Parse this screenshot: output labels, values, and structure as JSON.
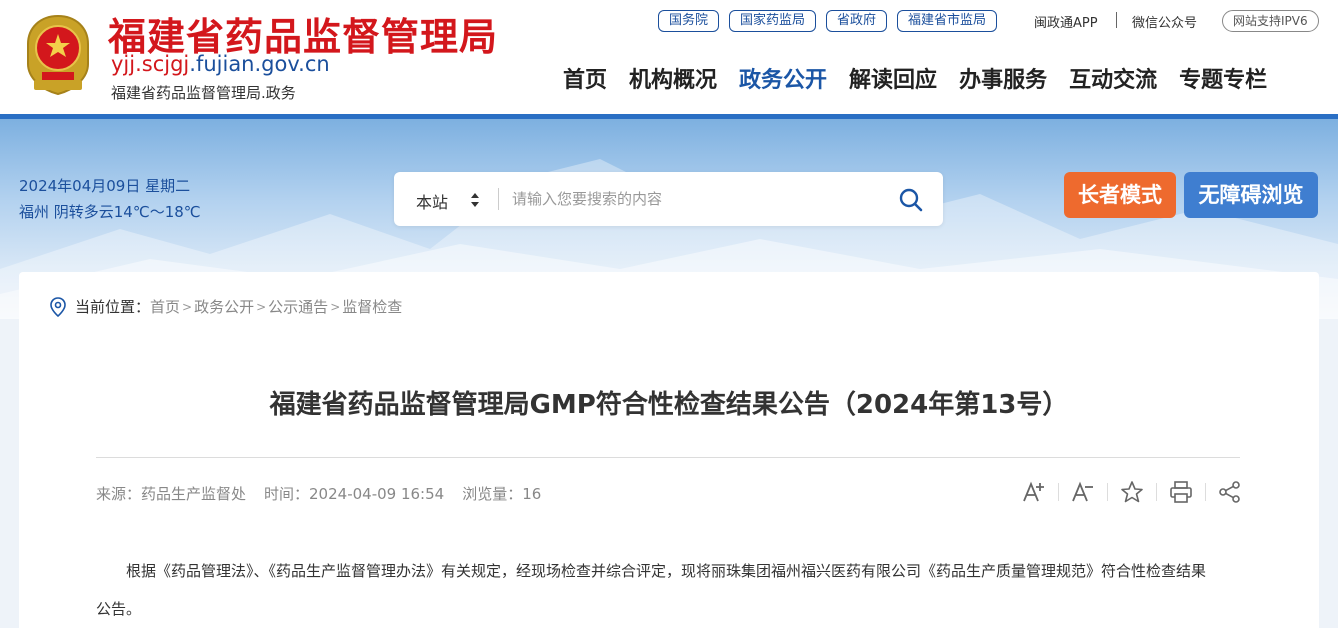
{
  "header": {
    "site_title": "福建省药品监督管理局",
    "domain_prefix": "yjj.scjgj",
    "domain_suffix": ".fujian.gov.cn",
    "subtitle": "福建省药品监督管理局.政务",
    "top_links": [
      "国务院",
      "国家药监局",
      "省政府",
      "福建省市监局"
    ],
    "app_link": "闽政通APP",
    "wechat_link": "微信公众号",
    "ipv6_badge": "网站支持IPV6"
  },
  "nav": {
    "items": [
      "首页",
      "机构概况",
      "政务公开",
      "解读回应",
      "办事服务",
      "互动交流",
      "专题专栏"
    ],
    "active": "政务公开"
  },
  "banner": {
    "date": "2024年04月09日 星期二",
    "weather": "福州 阴转多云14℃～18℃",
    "search_scope": "本站",
    "search_placeholder": "请输入您要搜索的内容",
    "elder_mode": "长者模式",
    "accessible": "无障碍浏览"
  },
  "breadcrumb": {
    "label": "当前位置：",
    "items": [
      "首页",
      "政务公开",
      "公示通告",
      "监督检查"
    ]
  },
  "article": {
    "title": "福建省药品监督管理局GMP符合性检查结果公告（2024年第13号）",
    "source": "来源：药品生产监督处",
    "time": "时间：2024-04-09 16:54",
    "views": "浏览量：16",
    "paragraph": "根据《药品管理法》、《药品生产监督管理办法》有关规定，经现场检查并综合评定，现将丽珠集团福州福兴医药有限公司《药品生产质量管理规范》符合性检查结果公告。"
  },
  "colors": {
    "brand_red": "#d3171c",
    "brand_blue": "#1b4f9c",
    "nav_active": "#1b56a6",
    "elder_btn": "#ee6a2e",
    "access_btn": "#3f7ed0"
  }
}
